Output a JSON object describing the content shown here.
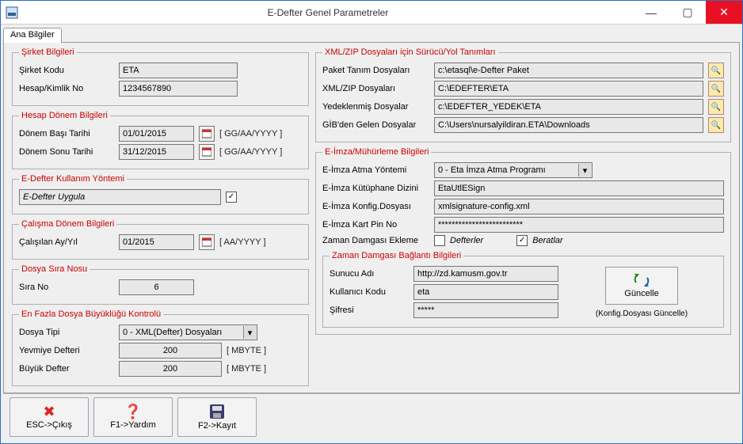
{
  "window": {
    "title": "E-Defter Genel Parametreler"
  },
  "tabs": {
    "main": "Ana Bilgiler"
  },
  "company": {
    "legend": "Şirket Bilgileri",
    "code_label": "Şirket Kodu",
    "code_value": "ETA",
    "account_label": "Hesap/Kimlik No",
    "account_value": "1234567890"
  },
  "period": {
    "legend": "Hesap Dönem Bilgileri",
    "start_label": "Dönem Başı Tarihi",
    "start_value": "01/01/2015",
    "end_label": "Dönem Sonu Tarihi",
    "end_value": "31/12/2015",
    "hint": "[ GG/AA/YYYY ]"
  },
  "usage": {
    "legend": "E-Defter Kullanım Yöntemi",
    "label": "E-Defter Uygula"
  },
  "workperiod": {
    "legend": "Çalışma Dönem Bilgileri",
    "label": "Çalışılan Ay/Yıl",
    "value": "01/2015",
    "hint": "[ AA/YYYY ]"
  },
  "seq": {
    "legend": "Dosya Sıra Nosu",
    "label": "Sıra No",
    "value": "6"
  },
  "filesize": {
    "legend": "En Fazla Dosya Büyüklüğü Kontrolü",
    "type_label": "Dosya Tipi",
    "type_value": "0 - XML(Defter) Dosyaları",
    "journal_label": "Yevmiye Defteri",
    "journal_value": "200",
    "ledger_label": "Büyük Defter",
    "ledger_value": "200",
    "unit": "[ MBYTE ]"
  },
  "paths": {
    "legend": "XML/ZIP Dosyaları için Sürücü/Yol Tanımları",
    "pkg_label": "Paket Tanım Dosyaları",
    "pkg_value": "c:\\etasql\\e-Defter Paket",
    "xml_label": "XML/ZIP Dosyaları",
    "xml_value": "C:\\EDEFTER\\ETA",
    "bak_label": "Yedeklenmiş Dosyalar",
    "bak_value": "c:\\EDEFTER_YEDEK\\ETA",
    "gib_label": "GİB'den Gelen Dosyalar",
    "gib_value": "C:\\Users\\nursalyildiran.ETA\\Downloads"
  },
  "esign": {
    "legend": "E-İmza/Mühürleme Bilgileri",
    "method_label": "E-İmza Atma Yöntemi",
    "method_value": "0 - Eta İmza Atma Programı",
    "lib_label": "E-İmza Kütüphane Dizini",
    "lib_value": "EtaUtlESign",
    "cfg_label": "E-İmza Konfig.Dosyası",
    "cfg_value": "xmlsignature-config.xml",
    "pin_label": "E-İmza Kart Pin No",
    "pin_value": "*************************",
    "ts_label": "Zaman Damgası Ekleme",
    "ts_opt1": "Defterler",
    "ts_opt2": "Beratlar"
  },
  "tsconn": {
    "legend": "Zaman Damgası Bağlantı Bilgileri",
    "server_label": "Sunucu Adı",
    "server_value": "http://zd.kamusm.gov.tr",
    "user_label": "Kullanıcı Kodu",
    "user_value": "eta",
    "pwd_label": "Şifresi",
    "pwd_value": "*****",
    "update_btn": "Güncelle",
    "update_hint": "(Konfig.Dosyası Güncelle)"
  },
  "bottombar": {
    "esc": "ESC->Çıkış",
    "f1": "F1->Yardım",
    "f2": "F2->Kayıt"
  }
}
